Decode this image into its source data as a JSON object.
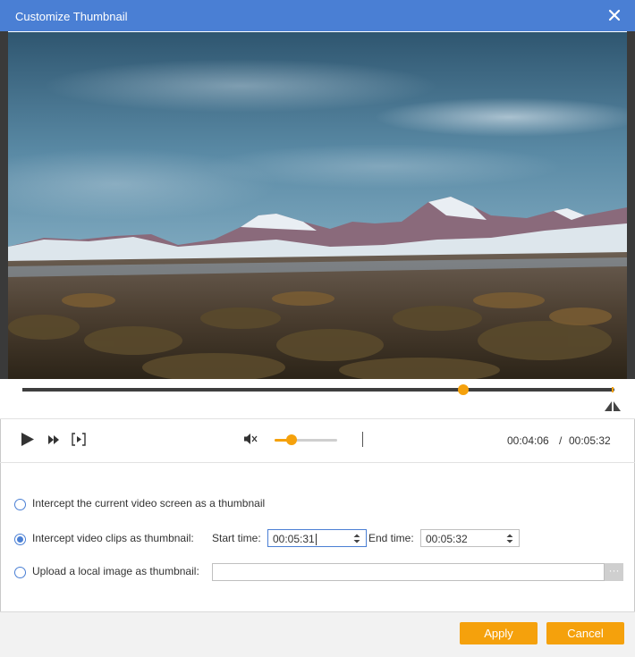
{
  "window": {
    "title": "Customize Thumbnail"
  },
  "icons": {
    "close": "close-icon",
    "play": "play-icon",
    "fast_forward": "fast-forward-icon",
    "clip": "clip-icon",
    "volume": "speaker-muted-icon",
    "split": "split-icon"
  },
  "player": {
    "progress_fraction": 0.744,
    "volume_fraction": 0.27,
    "current_time": "00:04:06",
    "separator": "/",
    "total_time": "00:05:32"
  },
  "options": {
    "current_screen": {
      "label": "Intercept the current video screen as a thumbnail",
      "selected": false
    },
    "video_clips": {
      "label": "Intercept video clips as thumbnail:",
      "selected": true,
      "start_label": "Start time:",
      "start_value": "00:05:31",
      "end_label": "End time:",
      "end_value": "00:05:32"
    },
    "local_image": {
      "label": "Upload a local image as thumbnail:",
      "selected": false,
      "path": "",
      "browse_label": "···"
    }
  },
  "footer": {
    "apply_label": "Apply",
    "cancel_label": "Cancel"
  },
  "colors": {
    "accent": "#f5a10c",
    "titlebar": "#4a7fd4"
  }
}
